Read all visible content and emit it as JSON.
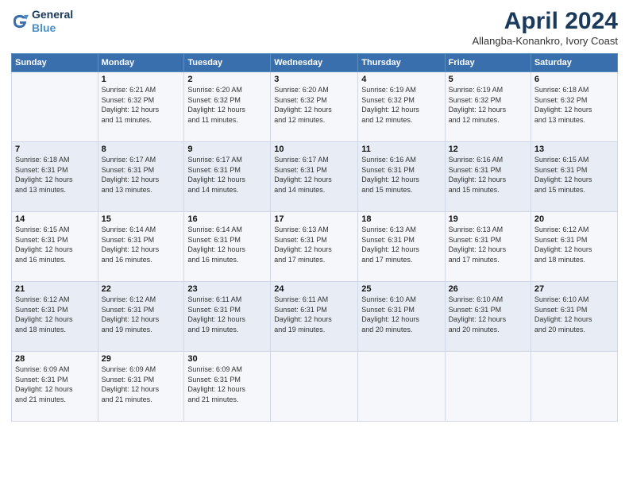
{
  "logo": {
    "line1": "General",
    "line2": "Blue"
  },
  "title": "April 2024",
  "subtitle": "Allangba-Konankro, Ivory Coast",
  "days_header": [
    "Sunday",
    "Monday",
    "Tuesday",
    "Wednesday",
    "Thursday",
    "Friday",
    "Saturday"
  ],
  "weeks": [
    [
      {
        "num": "",
        "info": ""
      },
      {
        "num": "1",
        "info": "Sunrise: 6:21 AM\nSunset: 6:32 PM\nDaylight: 12 hours\nand 11 minutes."
      },
      {
        "num": "2",
        "info": "Sunrise: 6:20 AM\nSunset: 6:32 PM\nDaylight: 12 hours\nand 11 minutes."
      },
      {
        "num": "3",
        "info": "Sunrise: 6:20 AM\nSunset: 6:32 PM\nDaylight: 12 hours\nand 12 minutes."
      },
      {
        "num": "4",
        "info": "Sunrise: 6:19 AM\nSunset: 6:32 PM\nDaylight: 12 hours\nand 12 minutes."
      },
      {
        "num": "5",
        "info": "Sunrise: 6:19 AM\nSunset: 6:32 PM\nDaylight: 12 hours\nand 12 minutes."
      },
      {
        "num": "6",
        "info": "Sunrise: 6:18 AM\nSunset: 6:32 PM\nDaylight: 12 hours\nand 13 minutes."
      }
    ],
    [
      {
        "num": "7",
        "info": "Sunrise: 6:18 AM\nSunset: 6:31 PM\nDaylight: 12 hours\nand 13 minutes."
      },
      {
        "num": "8",
        "info": "Sunrise: 6:17 AM\nSunset: 6:31 PM\nDaylight: 12 hours\nand 13 minutes."
      },
      {
        "num": "9",
        "info": "Sunrise: 6:17 AM\nSunset: 6:31 PM\nDaylight: 12 hours\nand 14 minutes."
      },
      {
        "num": "10",
        "info": "Sunrise: 6:17 AM\nSunset: 6:31 PM\nDaylight: 12 hours\nand 14 minutes."
      },
      {
        "num": "11",
        "info": "Sunrise: 6:16 AM\nSunset: 6:31 PM\nDaylight: 12 hours\nand 15 minutes."
      },
      {
        "num": "12",
        "info": "Sunrise: 6:16 AM\nSunset: 6:31 PM\nDaylight: 12 hours\nand 15 minutes."
      },
      {
        "num": "13",
        "info": "Sunrise: 6:15 AM\nSunset: 6:31 PM\nDaylight: 12 hours\nand 15 minutes."
      }
    ],
    [
      {
        "num": "14",
        "info": "Sunrise: 6:15 AM\nSunset: 6:31 PM\nDaylight: 12 hours\nand 16 minutes."
      },
      {
        "num": "15",
        "info": "Sunrise: 6:14 AM\nSunset: 6:31 PM\nDaylight: 12 hours\nand 16 minutes."
      },
      {
        "num": "16",
        "info": "Sunrise: 6:14 AM\nSunset: 6:31 PM\nDaylight: 12 hours\nand 16 minutes."
      },
      {
        "num": "17",
        "info": "Sunrise: 6:13 AM\nSunset: 6:31 PM\nDaylight: 12 hours\nand 17 minutes."
      },
      {
        "num": "18",
        "info": "Sunrise: 6:13 AM\nSunset: 6:31 PM\nDaylight: 12 hours\nand 17 minutes."
      },
      {
        "num": "19",
        "info": "Sunrise: 6:13 AM\nSunset: 6:31 PM\nDaylight: 12 hours\nand 17 minutes."
      },
      {
        "num": "20",
        "info": "Sunrise: 6:12 AM\nSunset: 6:31 PM\nDaylight: 12 hours\nand 18 minutes."
      }
    ],
    [
      {
        "num": "21",
        "info": "Sunrise: 6:12 AM\nSunset: 6:31 PM\nDaylight: 12 hours\nand 18 minutes."
      },
      {
        "num": "22",
        "info": "Sunrise: 6:12 AM\nSunset: 6:31 PM\nDaylight: 12 hours\nand 19 minutes."
      },
      {
        "num": "23",
        "info": "Sunrise: 6:11 AM\nSunset: 6:31 PM\nDaylight: 12 hours\nand 19 minutes."
      },
      {
        "num": "24",
        "info": "Sunrise: 6:11 AM\nSunset: 6:31 PM\nDaylight: 12 hours\nand 19 minutes."
      },
      {
        "num": "25",
        "info": "Sunrise: 6:10 AM\nSunset: 6:31 PM\nDaylight: 12 hours\nand 20 minutes."
      },
      {
        "num": "26",
        "info": "Sunrise: 6:10 AM\nSunset: 6:31 PM\nDaylight: 12 hours\nand 20 minutes."
      },
      {
        "num": "27",
        "info": "Sunrise: 6:10 AM\nSunset: 6:31 PM\nDaylight: 12 hours\nand 20 minutes."
      }
    ],
    [
      {
        "num": "28",
        "info": "Sunrise: 6:09 AM\nSunset: 6:31 PM\nDaylight: 12 hours\nand 21 minutes."
      },
      {
        "num": "29",
        "info": "Sunrise: 6:09 AM\nSunset: 6:31 PM\nDaylight: 12 hours\nand 21 minutes."
      },
      {
        "num": "30",
        "info": "Sunrise: 6:09 AM\nSunset: 6:31 PM\nDaylight: 12 hours\nand 21 minutes."
      },
      {
        "num": "",
        "info": ""
      },
      {
        "num": "",
        "info": ""
      },
      {
        "num": "",
        "info": ""
      },
      {
        "num": "",
        "info": ""
      }
    ]
  ]
}
